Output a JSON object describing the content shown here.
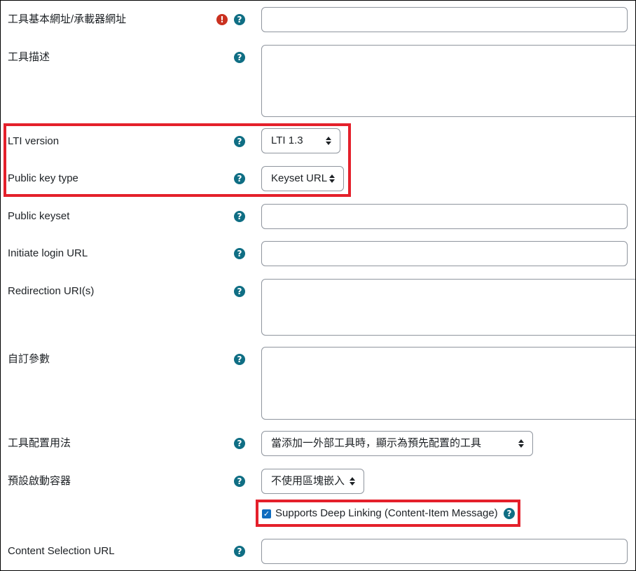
{
  "fields": {
    "tool_base_url": {
      "label": "工具基本網址/承載器網址",
      "value": ""
    },
    "tool_description": {
      "label": "工具描述",
      "value": ""
    },
    "lti_version": {
      "label": "LTI version",
      "value": "LTI 1.3"
    },
    "public_key_type": {
      "label": "Public key type",
      "value": "Keyset URL"
    },
    "public_keyset": {
      "label": "Public keyset",
      "value": ""
    },
    "initiate_login_url": {
      "label": "Initiate login URL",
      "value": ""
    },
    "redirection_uris": {
      "label": "Redirection URI(s)",
      "value": ""
    },
    "custom_params": {
      "label": "自訂參數",
      "value": ""
    },
    "tool_config_usage": {
      "label": "工具配置用法",
      "value": "當添加一外部工具時，顯示為預先配置的工具"
    },
    "default_launch_container": {
      "label": "預設啟動容器",
      "value": "不使用區塊嵌入"
    },
    "deep_linking": {
      "label": "Supports Deep Linking (Content-Item Message)",
      "checked": true
    },
    "content_selection_url": {
      "label": "Content Selection URL",
      "value": ""
    }
  },
  "icons": {
    "help": "question-circle-icon",
    "required": "exclamation-circle-icon",
    "check": "checkmark-icon"
  },
  "colors": {
    "help": "#0f6e84",
    "required": "#ca3120",
    "highlight": "#e4202b",
    "checkbox": "#0f6cbf"
  }
}
